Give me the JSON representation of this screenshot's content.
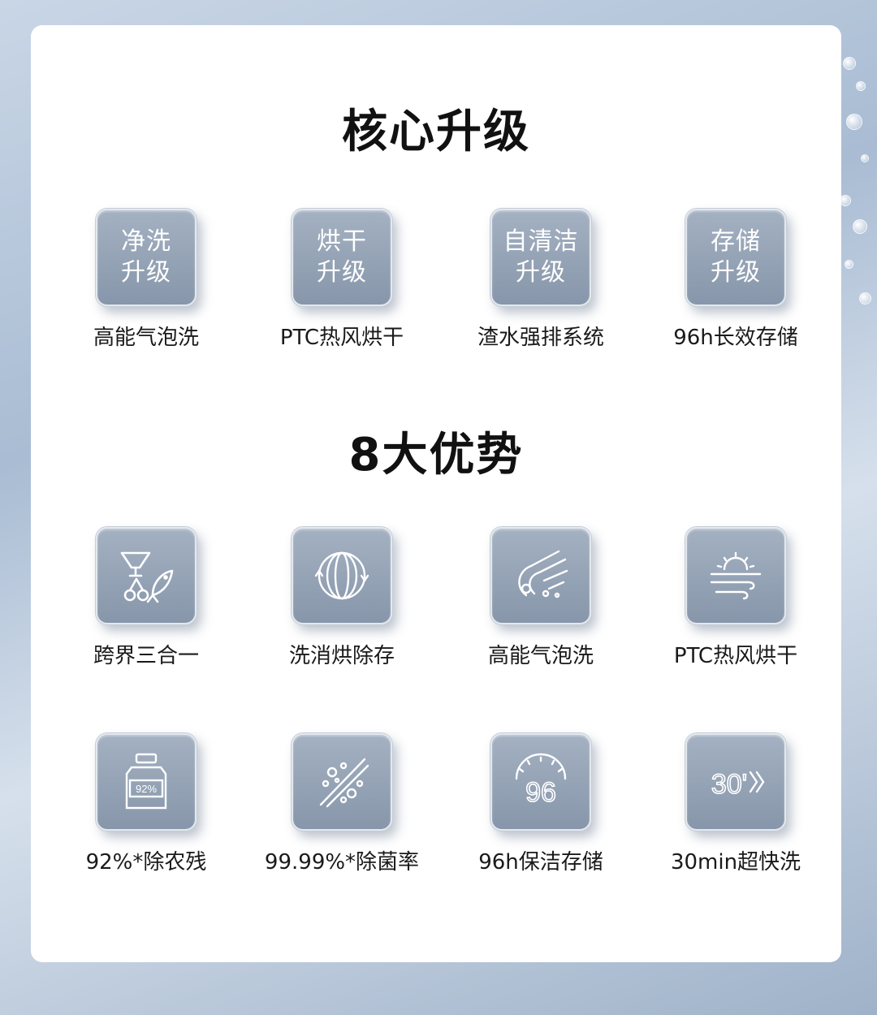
{
  "titles": {
    "core": "核心升级",
    "advantages": "8大优势"
  },
  "core_items": [
    {
      "line1": "净洗",
      "line2": "升级",
      "caption": "高能气泡洗"
    },
    {
      "line1": "烘干",
      "line2": "升级",
      "caption": "PTC热风烘干"
    },
    {
      "line1": "自清洁",
      "line2": "升级",
      "caption": "渣水强排系统"
    },
    {
      "line1": "存储",
      "line2": "升级",
      "caption": "96h长效存储"
    }
  ],
  "advantages": [
    {
      "icon": "bowl-cherry-fish-icon",
      "caption": "跨界三合一"
    },
    {
      "icon": "circular-cycle-icon",
      "caption": "洗消烘除存"
    },
    {
      "icon": "bubble-stream-icon",
      "caption": "高能气泡洗"
    },
    {
      "icon": "hot-wind-sun-icon",
      "caption": "PTC热风烘干"
    },
    {
      "icon": "bottle-percent-icon",
      "icon_text": "92%",
      "caption": "92%*除农残"
    },
    {
      "icon": "germ-strike-icon",
      "caption": "99.99%*除菌率"
    },
    {
      "icon": "96-gauge-icon",
      "icon_text": "96",
      "caption": "96h保洁存储"
    },
    {
      "icon": "30-min-fast-icon",
      "icon_text": "30'",
      "caption": "30min超快洗"
    }
  ]
}
